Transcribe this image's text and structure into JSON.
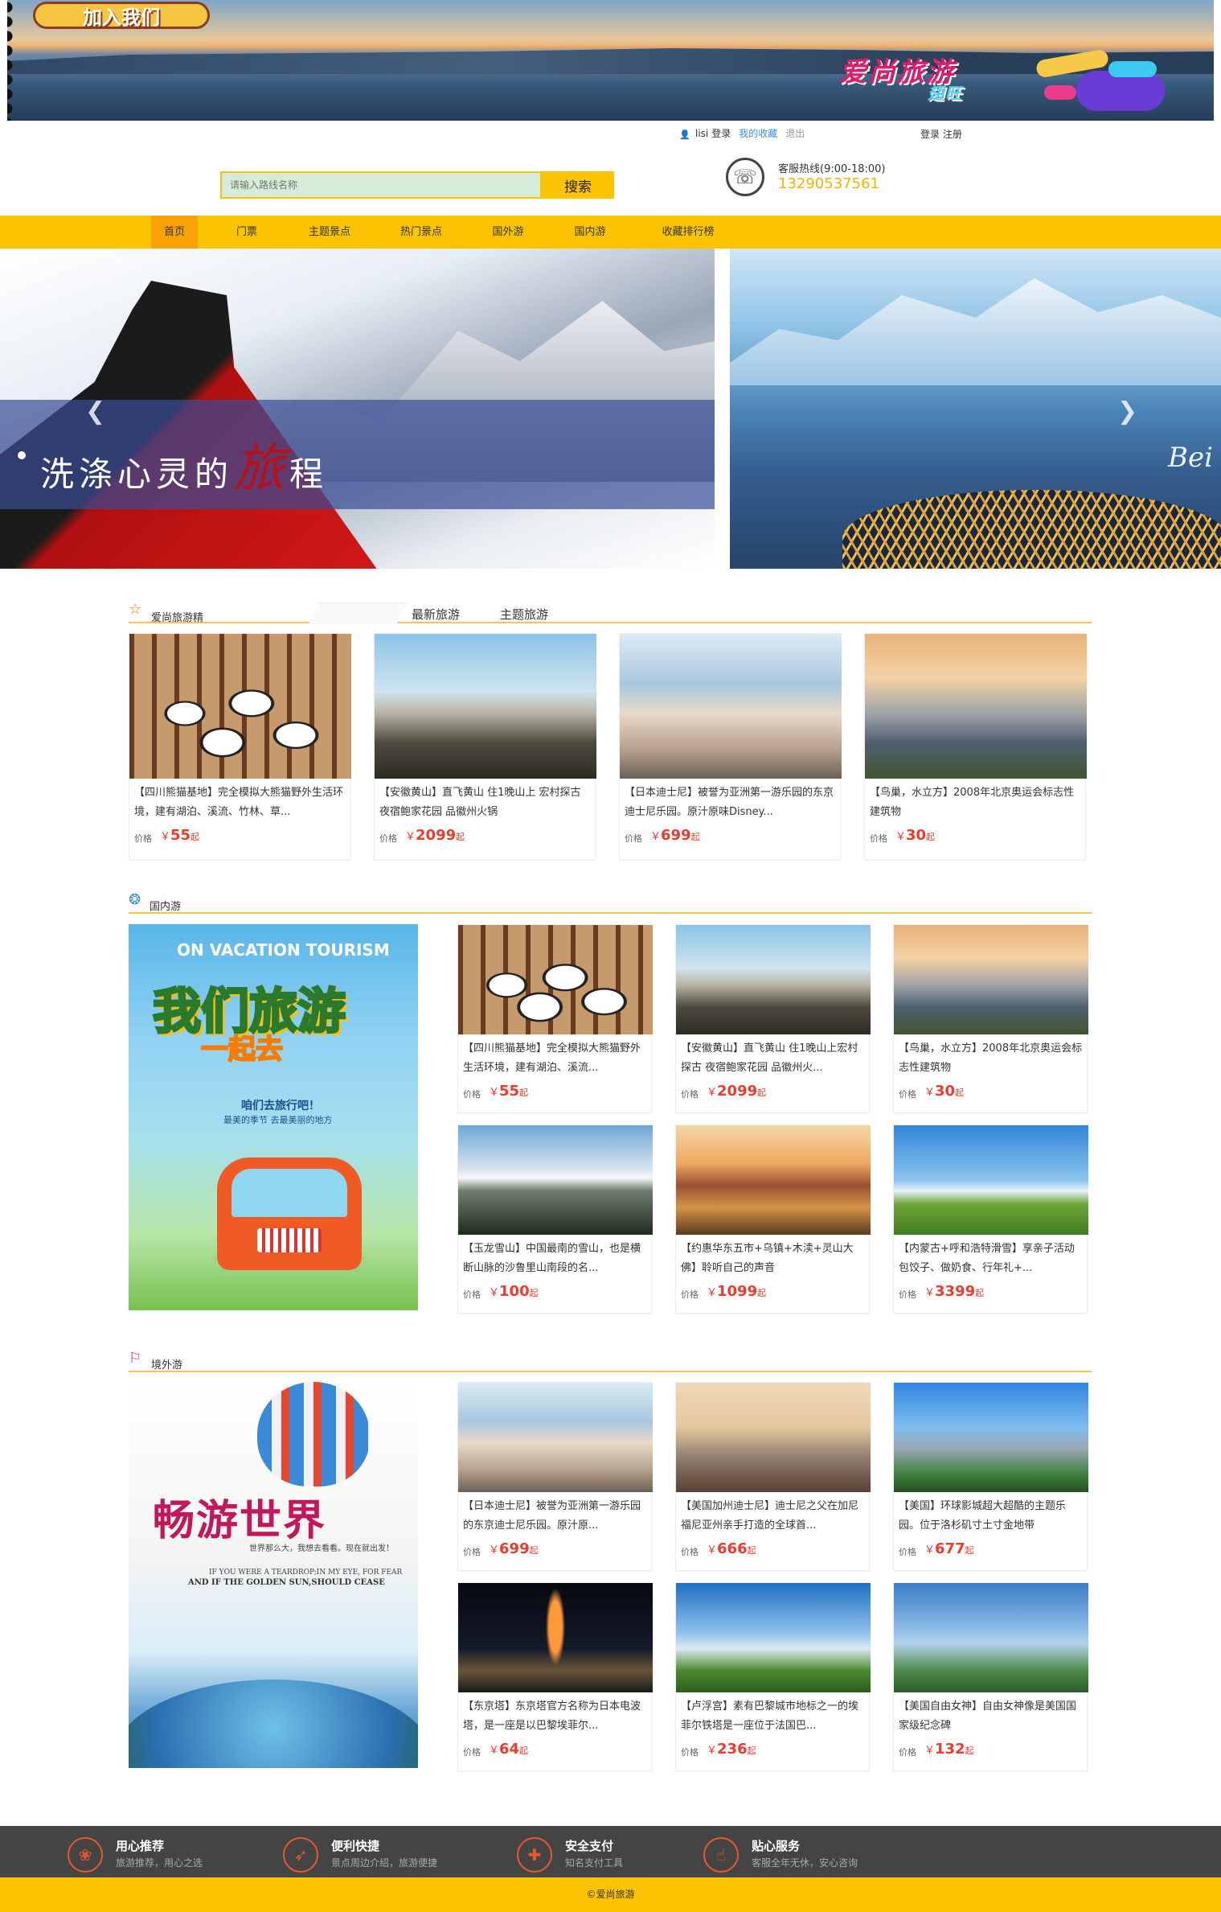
{
  "header": {
    "join_badge": "加入我们",
    "brand_name": "爱尚旅游",
    "brand_sub": "翅旺"
  },
  "login_bar": {
    "user": "lisi",
    "login": "登录",
    "favorites": "我的收藏",
    "logout": "退出",
    "login_register": "登录 注册"
  },
  "search": {
    "placeholder": "请输入路线名称",
    "button": "搜索"
  },
  "hotline": {
    "label": "客服热线(9:00-18:00)",
    "number": "13290537561"
  },
  "nav": {
    "items": [
      "首页",
      "门票",
      "主题景点",
      "热门景点",
      "国外游",
      "国内游",
      "收藏排行榜"
    ]
  },
  "carousel": {
    "caption_a": "洗涤心灵的",
    "caption_big": "旅",
    "caption_b": "程",
    "right_text": "Bei"
  },
  "featured": {
    "title": "爱尚旅游精",
    "tabs": [
      "最新旅游",
      "主题旅游"
    ],
    "cards": [
      {
        "desc": "【四川熊猫基地】完全模拟大熊猫野外生活环境，建有湖泊、溪流、竹林、草...",
        "price_label": "价格",
        "currency": "￥",
        "price": "55",
        "unit": "起",
        "img": "panda"
      },
      {
        "desc": "【安徽黄山】直飞黄山 住1晚山上 宏村探古 夜宿鲍家花园 品徽州火锅",
        "price_label": "价格",
        "currency": "￥",
        "price": "2099",
        "unit": "起",
        "img": "huangshan"
      },
      {
        "desc": "【日本迪士尼】被誉为亚洲第一游乐园的东京迪士尼乐园。原汁原味Disney...",
        "price_label": "价格",
        "currency": "￥",
        "price": "699",
        "unit": "起",
        "img": "disney"
      },
      {
        "desc": "【鸟巢，水立方】2008年北京奥运会标志性建筑物",
        "price_label": "价格",
        "currency": "￥",
        "price": "30",
        "unit": "起",
        "img": "nest"
      }
    ]
  },
  "domestic": {
    "title": "国内游",
    "poster": {
      "en": "ON VACATION TOURISM",
      "title_a": "我们",
      "title_b": "旅游",
      "sub": "一起去",
      "tag1": "咱们去旅行吧！",
      "tag2": "最美的季节 去最美丽的地方"
    },
    "cards": [
      {
        "desc": "【四川熊猫基地】完全模拟大熊猫野外生活环境，建有湖泊、溪流...",
        "price_label": "价格",
        "currency": "￥",
        "price": "55",
        "unit": "起",
        "img": "panda"
      },
      {
        "desc": "【安徽黄山】直飞黄山 住1晚山上宏村探古 夜宿鲍家花园 品徽州火...",
        "price_label": "价格",
        "currency": "￥",
        "price": "2099",
        "unit": "起",
        "img": "huangshan"
      },
      {
        "desc": "【鸟巢，水立方】2008年北京奥运会标志性建筑物",
        "price_label": "价格",
        "currency": "￥",
        "price": "30",
        "unit": "起",
        "img": "nest"
      },
      {
        "desc": "【玉龙雪山】中国最南的雪山，也是横断山脉的沙鲁里山南段的名...",
        "price_label": "价格",
        "currency": "￥",
        "price": "100",
        "unit": "起",
        "img": "yulong"
      },
      {
        "desc": "【约惠华东五市+乌镇+木渎+灵山大佛】聆听自己的声音",
        "price_label": "价格",
        "currency": "￥",
        "price": "1099",
        "unit": "起",
        "img": "wuzhen"
      },
      {
        "desc": "【内蒙古+呼和浩特滑雪】享亲子活动包饺子、做奶食、行年礼+...",
        "price_label": "价格",
        "currency": "￥",
        "price": "3399",
        "unit": "起",
        "img": "neimeng"
      }
    ]
  },
  "abroad": {
    "title": "境外游",
    "poster": {
      "title": "畅游世界",
      "sub": "世界那么大，我想去看看。现在就出发！",
      "en1": "IF YOU WERE A TEARDROP;IN MY EYE, FOR FEAR",
      "en2": "AND IF THE GOLDEN SUN,SHOULD CEASE"
    },
    "cards": [
      {
        "desc": "【日本迪士尼】被誉为亚洲第一游乐园的东京迪士尼乐园。原汁原...",
        "price_label": "价格",
        "currency": "￥",
        "price": "699",
        "unit": "起",
        "img": "disney"
      },
      {
        "desc": "【美国加州迪士尼】迪士尼之父在加尼福尼亚州亲手打造的全球首...",
        "price_label": "价格",
        "currency": "￥",
        "price": "666",
        "unit": "起",
        "img": "disney-ca"
      },
      {
        "desc": "【美国】环球影城超大超酷的主题乐园。位于洛杉矶寸土寸金地带",
        "price_label": "价格",
        "currency": "￥",
        "price": "677",
        "unit": "起",
        "img": "universal"
      },
      {
        "desc": "【东京塔】东京塔官方名称为日本电波塔，是一座是以巴黎埃菲尔...",
        "price_label": "价格",
        "currency": "￥",
        "price": "64",
        "unit": "起",
        "img": "tokyo"
      },
      {
        "desc": "【卢浮宫】素有巴黎城市地标之一的埃菲尔铁塔是一座位于法国巴...",
        "price_label": "价格",
        "currency": "￥",
        "price": "236",
        "unit": "起",
        "img": "eiffel"
      },
      {
        "desc": "【美国自由女神】自由女神像是美国国家级纪念碑",
        "price_label": "价格",
        "currency": "￥",
        "price": "132",
        "unit": "起",
        "img": "liberty"
      }
    ]
  },
  "footer": {
    "services": [
      {
        "title": "用心推荐",
        "sub": "旅游推荐，用心之选",
        "icon": "recommend-icon",
        "glyph": "❀"
      },
      {
        "title": "便利快捷",
        "sub": "景点周边介绍，旅游便捷",
        "icon": "rocket-icon",
        "glyph": "➶"
      },
      {
        "title": "安全支付",
        "sub": "知名支付工具",
        "icon": "shield-icon",
        "glyph": "✚"
      },
      {
        "title": "贴心服务",
        "sub": "客服全年无休，安心咨询",
        "icon": "thumb-icon",
        "glyph": "☝"
      }
    ],
    "copyright": "©爱尚旅游"
  },
  "colors": {
    "brand_yellow": "#fcc300",
    "nav_active": "#f8a206",
    "price_red": "#ef3a2d"
  }
}
